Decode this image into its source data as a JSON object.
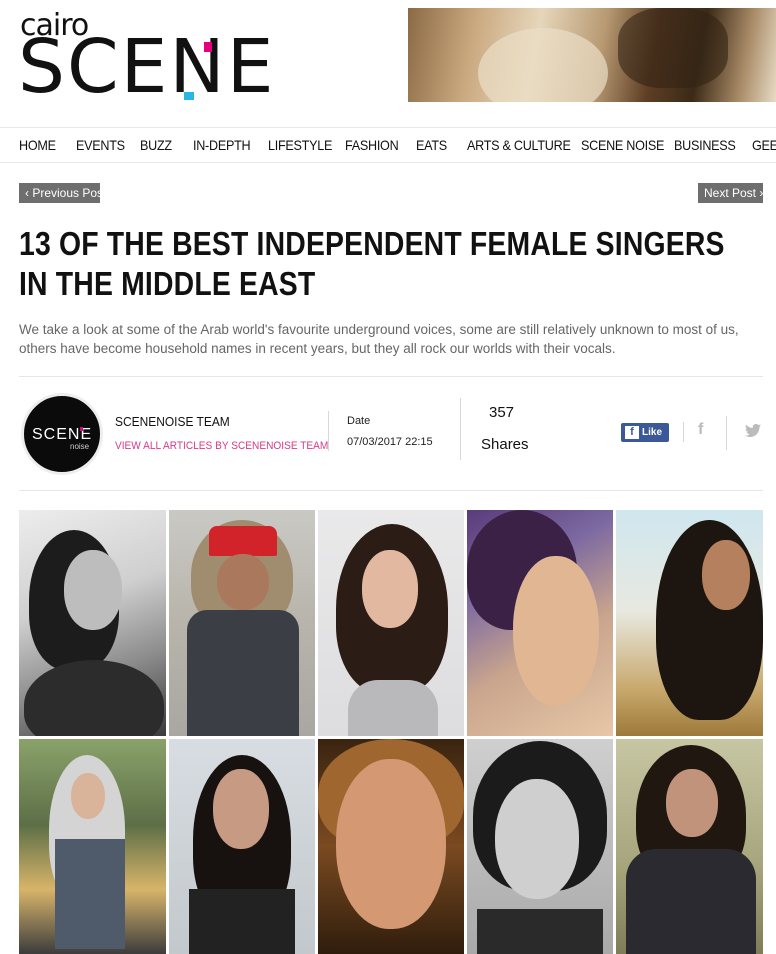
{
  "header": {
    "logo_small": "cairo",
    "logo_big": "SCENE",
    "brand_colors": {
      "pink": "#e5007d",
      "cyan": "#2ab7e6"
    }
  },
  "nav": {
    "items": [
      "HOME",
      "EVENTS",
      "BUZZ",
      "IN-DEPTH",
      "LIFESTYLE",
      "FASHION",
      "EATS",
      "ARTS & CULTURE",
      "SCENE NOISE",
      "BUSINESS",
      "GEEK"
    ]
  },
  "post_nav": {
    "previous": "Previous Post",
    "next": "Next Post"
  },
  "article": {
    "title": "13 OF THE BEST INDEPENDENT FEMALE SINGERS IN THE MIDDLE EAST",
    "lede": "We take a look at some of the Arab world's favourite underground voices, some are still relatively unknown to most of us, others have become household names in recent years, but they all rock our worlds with their vocals."
  },
  "author": {
    "avatar_text": "SCENE",
    "avatar_sub": "noise",
    "name": "SCENENOISE TEAM",
    "link": "VIEW ALL ARTICLES BY SCENENOISE TEAM"
  },
  "meta": {
    "date_label": "Date",
    "date_value": "07/03/2017 22:15",
    "share_count": "357",
    "share_label": "Shares",
    "like_label": "Like"
  },
  "social": {
    "facebook_icon": "f",
    "twitter_icon": "twitter-bird"
  }
}
